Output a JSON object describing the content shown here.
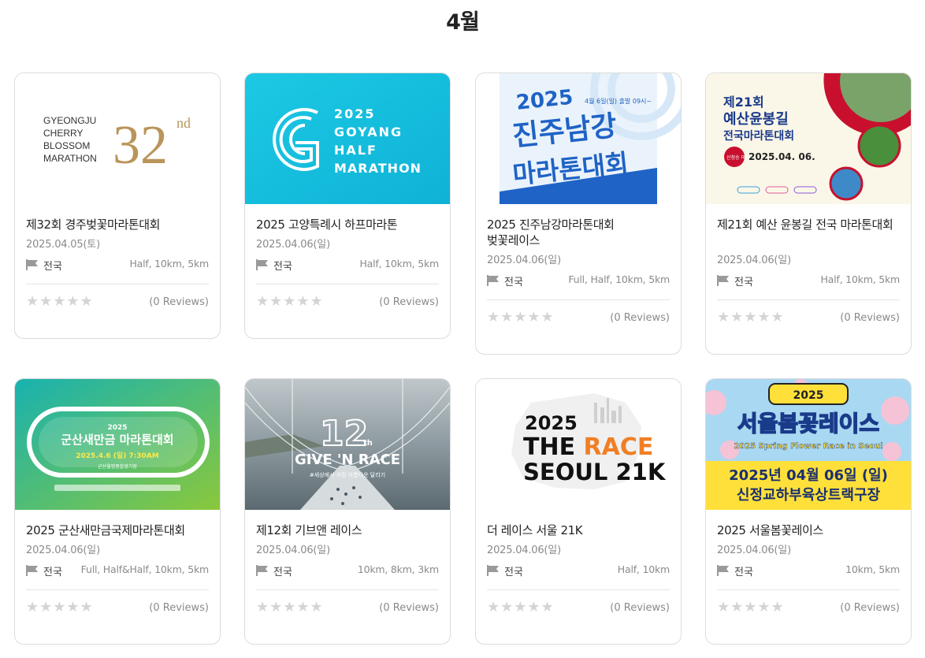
{
  "page": {
    "month_title": "4월"
  },
  "cards": [
    {
      "name": "제32회 경주벚꽃마라톤대회",
      "date": "2025.04.05(토)",
      "region": "전국",
      "courses": "Half, 10km, 5km",
      "reviews": "(0 Reviews)",
      "poster": {
        "lines": [
          "GYEONGJU",
          "CHERRY",
          "BLOSSOM",
          "MARATHON"
        ],
        "number": "32",
        "suffix": "nd"
      }
    },
    {
      "name": "2025 고양특례시 하프마라톤",
      "date": "2025.04.06(일)",
      "region": "전국",
      "courses": "Half, 10km, 5km",
      "reviews": "(0 Reviews)",
      "poster": {
        "lines": [
          "2025",
          "GOYANG",
          "HALF",
          "MARATHON"
        ]
      }
    },
    {
      "name": "2025 진주남강마라톤대회 벚꽃레이스",
      "date": "2025.04.06(일)",
      "region": "전국",
      "courses": "Full, Half, 10km, 5km",
      "reviews": "(0 Reviews)",
      "poster": {
        "year": "2025",
        "title_1": "진주남강",
        "title_2": "마라톤대회",
        "date_note": "4월 6일(일) 출발 09시~"
      }
    },
    {
      "name": "제21회 예산 윤봉길 전국 마라톤대회",
      "date": "2025.04.06(일)",
      "region": "전국",
      "courses": "Half, 10km, 5km",
      "reviews": "(0 Reviews)",
      "poster": {
        "line_1": "제21회",
        "line_2": "예산윤봉길",
        "line_3": "전국마라톤대회",
        "date_text": "2025.04. 06.",
        "badge": "신청승 마감"
      }
    },
    {
      "name": "2025 군산새만금국제마라톤대회",
      "date": "2025.04.06(일)",
      "region": "전국",
      "courses": "Full, Half&Half, 10km, 5km",
      "reviews": "(0 Reviews)",
      "poster": {
        "year": "2025",
        "title": "군산새만금 마라톤대회",
        "date_text": "2025.4.6 (일) 7:30AM",
        "place": "군산월명종합경기장"
      }
    },
    {
      "name": "제12회 기브앤 레이스",
      "date": "2025.04.06(일)",
      "region": "전국",
      "courses": "10km, 8km, 3km",
      "reviews": "(0 Reviews)",
      "poster": {
        "number": "12",
        "suffix": "th",
        "title": "GIVE 'N RACE",
        "subtitle": "#세상에서 가장 아름다운 달리기"
      }
    },
    {
      "name": "더 레이스 서울 21K",
      "date": "2025.04.06(일)",
      "region": "전국",
      "courses": "Half, 10km",
      "reviews": "(0 Reviews)",
      "poster": {
        "line_1": "2025",
        "line_2a": "THE ",
        "line_2b": "RACE",
        "line_3": "SEOUL 21K"
      }
    },
    {
      "name": "2025 서울봄꽃레이스",
      "date": "2025.04.06(일)",
      "region": "전국",
      "courses": "10km, 5km",
      "reviews": "(0 Reviews)",
      "poster": {
        "year": "2025",
        "title": "서울봄꽃레이스",
        "subtitle": "2025 Spring Flower Race in Seoul",
        "date_text": "2025년 04월 06일 (일)",
        "place": "신정교하부육상트랙구장"
      }
    }
  ],
  "stars": "★★★★★",
  "colors": {
    "gold": "#b9955a",
    "goyang_cyan": "#19c0dc",
    "jinju_blue": "#1f63c6",
    "race_orange": "#f07f24",
    "seoul_yellow": "#ffe03a"
  }
}
